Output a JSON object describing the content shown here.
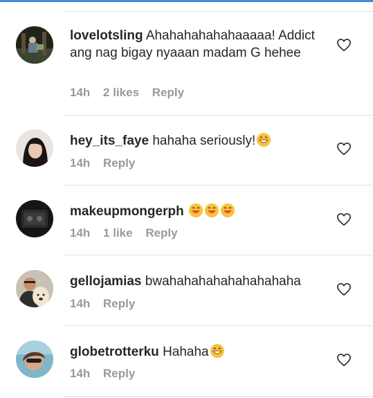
{
  "comments": [
    {
      "username": "lovelotsling",
      "text": "Ahahahahahahaaaaa! Addict ang nag bigay nyaaan madam G hehee",
      "emojis": 0,
      "time": "14h",
      "likes": "2 likes",
      "reply": "Reply",
      "avatar": "avatar-dark-photo"
    },
    {
      "username": "hey_its_faye",
      "text": "hahaha seriously!",
      "emojis": 1,
      "time": "14h",
      "likes": "",
      "reply": "Reply",
      "avatar": "avatar-woman-portrait"
    },
    {
      "username": "makeupmongerph",
      "text": "",
      "emojis": 3,
      "time": "14h",
      "likes": "1 like",
      "reply": "Reply",
      "avatar": "avatar-makeup-case"
    },
    {
      "username": "gellojamias",
      "text": "bwahahahahahahahahaha",
      "emojis": 0,
      "time": "14h",
      "likes": "",
      "reply": "Reply",
      "avatar": "avatar-man-with-dog"
    },
    {
      "username": "globetrotterku",
      "text": "Hahaha",
      "emojis": 1,
      "time": "14h",
      "likes": "",
      "reply": "Reply",
      "avatar": "avatar-sunglasses"
    }
  ],
  "icons": {
    "like": "heart-outline-icon",
    "emoji": "grinning-face-emoji"
  },
  "colors": {
    "text": "#262626",
    "meta": "#999999",
    "accent_bar": "#3f8ed8",
    "divider": "#e3e3e3"
  }
}
